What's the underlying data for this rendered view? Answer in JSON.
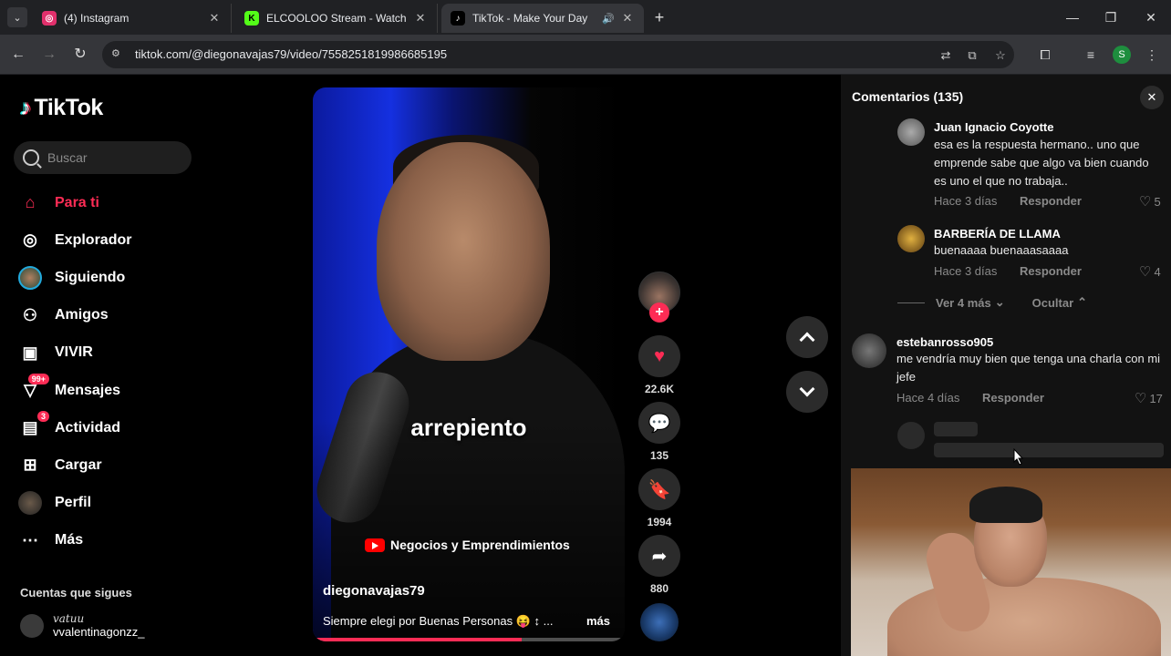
{
  "browser": {
    "tabs": [
      {
        "title": "(4) Instagram",
        "favicon": "instagram-icon",
        "color": "#e1306c",
        "glyph": "◎",
        "active": false
      },
      {
        "title": "ELCOOLOO Stream - Watch Live",
        "favicon": "kick-icon",
        "color": "#53fc18",
        "glyph": "K",
        "active": false
      },
      {
        "title": "TikTok - Make Your Day",
        "favicon": "tiktok-icon",
        "color": "#000000",
        "glyph": "♪",
        "active": true
      }
    ],
    "url": "tiktok.com/@diegonavajas79/video/7558251819986685195",
    "profile_initial": "S"
  },
  "sidebar": {
    "logo_text": "TikTok",
    "search_placeholder": "Buscar",
    "nav": [
      {
        "label": "Para ti",
        "icon": "home-icon",
        "glyph": "⌂",
        "active": true
      },
      {
        "label": "Explorador",
        "icon": "compass-icon",
        "glyph": "◎"
      },
      {
        "label": "Siguiendo",
        "icon": "following-avatar-icon",
        "glyph": "●"
      },
      {
        "label": "Amigos",
        "icon": "friends-icon",
        "glyph": "⚇"
      },
      {
        "label": "VIVIR",
        "icon": "live-tv-icon",
        "glyph": "▣"
      },
      {
        "label": "Mensajes",
        "icon": "messages-icon",
        "glyph": "▽",
        "badge": "99+"
      },
      {
        "label": "Actividad",
        "icon": "activity-icon",
        "glyph": "▤",
        "badge": "3"
      },
      {
        "label": "Cargar",
        "icon": "upload-icon",
        "glyph": "⊞"
      },
      {
        "label": "Perfil",
        "icon": "profile-avatar-icon",
        "glyph": "●"
      },
      {
        "label": "Más",
        "icon": "more-icon",
        "glyph": "⋯"
      }
    ],
    "following_title": "Cuentas que sigues",
    "following": [
      {
        "nick": "vatuu",
        "user": "vvalentinagonzz_"
      }
    ]
  },
  "video": {
    "caption": "arrepiento",
    "source_badge": "Negocios y Emprendimientos",
    "author": "diegonavajas79",
    "description": "Siempre elegi por Buenas Personas 😝 ↕ ...",
    "more_label": "más",
    "progress": 0.67
  },
  "actions": {
    "likes": "22.6K",
    "comments": "135",
    "saves": "1994",
    "shares": "880"
  },
  "comments_panel": {
    "title": "Comentarios (135)",
    "items": [
      {
        "user": "Juan Ignacio Coyotte",
        "text": "esa es la respuesta hermano.. uno que emprende sabe que algo va bien cuando es uno el que no trabaja..",
        "time": "Hace 3 días",
        "reply": "Responder",
        "likes": "5"
      },
      {
        "user": "BARBERÍA DE LLAMA",
        "text": "buenaaaa buenaaasaaaa",
        "time": "Hace 3 días",
        "reply": "Responder",
        "likes": "4"
      },
      {
        "user": "estebanrosso905",
        "text": "me vendría muy bien que tenga una charla con mi jefe",
        "time": "Hace 4 días",
        "reply": "Responder",
        "likes": "17"
      }
    ],
    "view_more": "Ver 4 más",
    "hide": "Ocultar"
  }
}
